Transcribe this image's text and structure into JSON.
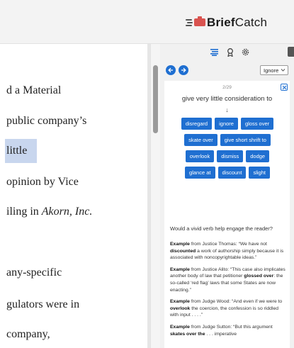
{
  "brand": {
    "name_bold": "Brief",
    "name_rest": "Catch"
  },
  "document": {
    "lines": [
      {
        "text": "d a Material",
        "italic": ""
      },
      {
        "text": "public company’s",
        "italic": ""
      },
      {
        "text": "little",
        "italic": "",
        "highlight": true
      },
      {
        "text": "opinion by Vice",
        "italic": ""
      },
      {
        "text": "iling in ",
        "italic": "Akorn, Inc."
      },
      {
        "text": "any-specific",
        "italic": ""
      },
      {
        "text": "gulators were in",
        "italic": ""
      },
      {
        "text": "company,",
        "italic": ""
      }
    ]
  },
  "panel": {
    "tabs": [
      "list-icon",
      "award-icon",
      "gear-icon"
    ],
    "filter": {
      "selected": "Ignore"
    },
    "card": {
      "counter": "2/29",
      "phrase": "give very little consideration to",
      "arrow": "↓",
      "suggestions": [
        [
          "disregard",
          "ignore",
          "gloss over"
        ],
        [
          "skate over",
          "give short shrift to"
        ],
        [
          "overlook",
          "dismiss",
          "dodge"
        ],
        [
          "glance at",
          "discount",
          "slight"
        ]
      ],
      "question": "Would a vivid verb help engage the reader?",
      "examples": [
        {
          "label": "Example",
          "pre": " from Justice Thomas: “We have not ",
          "bold": "discounted",
          "post": " a work of authorship simply because it is associated with noncopyrightable ideas.”"
        },
        {
          "label": "Example",
          "pre": " from Justice Alito: “This case also implicates another body of law that petitioner ",
          "bold": "glossed over",
          "post": ": the so-called ‘red flag’ laws that some States are now enacting.”"
        },
        {
          "label": "Example",
          "pre": " from Judge Wood: “And even if we were to ",
          "bold": "overlook",
          "post": " the coercion, the confession is so riddled with input . . . .”"
        },
        {
          "label": "Example",
          "pre": " from Judge Sutton: “But this argument ",
          "bold": "skates over the",
          "post": " . . . imperative"
        }
      ]
    }
  },
  "colors": {
    "accent": "#1f6fd1",
    "highlight": "#c8d6ee",
    "brand_red": "#d9534f"
  }
}
